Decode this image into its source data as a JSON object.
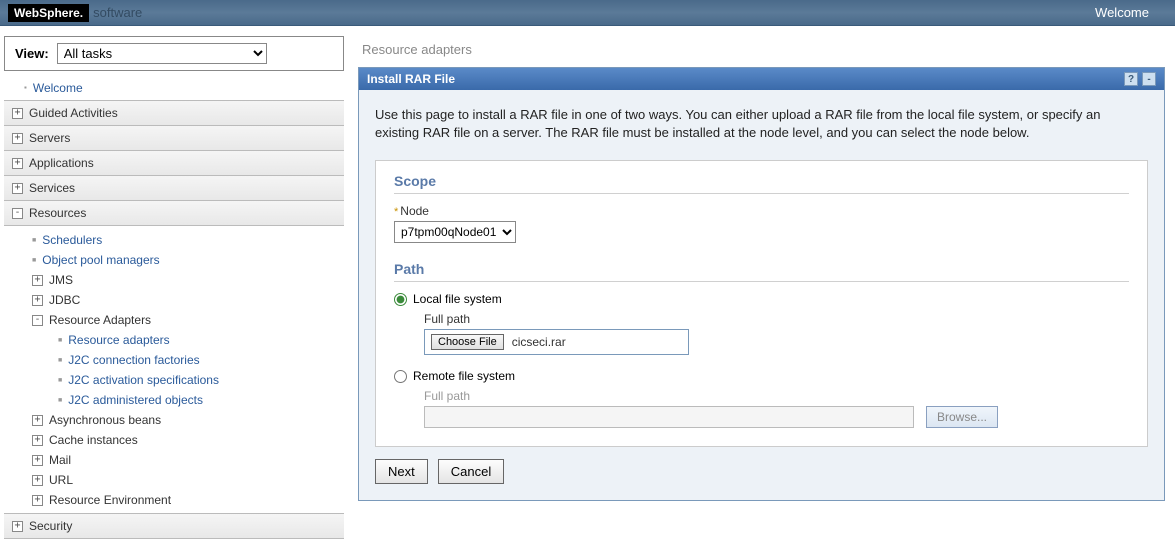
{
  "header": {
    "logo": "WebSphere.",
    "logo_sub": "software",
    "welcome": "Welcome"
  },
  "sidebar": {
    "view_label": "View:",
    "view_selected": "All tasks",
    "welcome_link": "Welcome",
    "sections": {
      "guided": "Guided Activities",
      "servers": "Servers",
      "applications": "Applications",
      "services": "Services",
      "resources": "Resources",
      "security": "Security"
    },
    "resources_children": {
      "schedulers": "Schedulers",
      "opm": "Object pool managers",
      "jms": "JMS",
      "jdbc": "JDBC",
      "ra": "Resource Adapters",
      "ra_children": {
        "ra": "Resource adapters",
        "j2c_cf": "J2C connection factories",
        "j2c_as": "J2C activation specifications",
        "j2c_ao": "J2C administered objects"
      },
      "async": "Asynchronous beans",
      "cache": "Cache instances",
      "mail": "Mail",
      "url": "URL",
      "renv": "Resource Environment"
    }
  },
  "main": {
    "breadcrumb": "Resource adapters",
    "panel_title": "Install RAR File",
    "description": "Use this page to install a RAR file in one of two ways. You can either upload a RAR file from the local file system, or specify an existing RAR file on a server. The RAR file must be installed at the node level, and you can select the node below.",
    "scope": {
      "legend": "Scope",
      "node_label": "Node",
      "node_value": "p7tpm00qNode01"
    },
    "path": {
      "legend": "Path",
      "local_label": "Local file system",
      "full_path_label": "Full path",
      "choose_file": "Choose File",
      "selected_file": "cicseci.rar",
      "remote_label": "Remote file system",
      "remote_full_path_label": "Full path",
      "browse": "Browse..."
    },
    "buttons": {
      "next": "Next",
      "cancel": "Cancel"
    }
  }
}
